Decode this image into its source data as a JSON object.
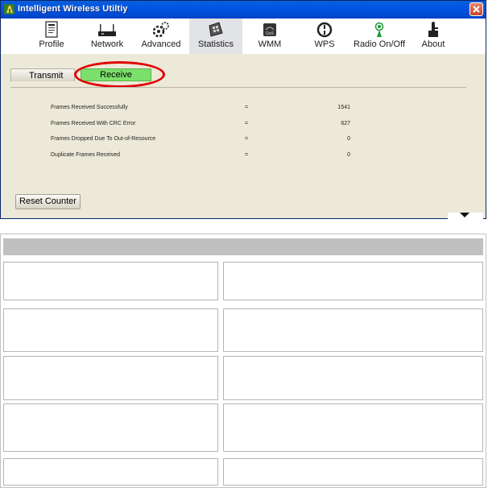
{
  "window": {
    "title": "Intelligent Wireless Utiltiy"
  },
  "toolbar": {
    "items": [
      {
        "label": "Profile",
        "icon": "profile-icon"
      },
      {
        "label": "Network",
        "icon": "network-icon"
      },
      {
        "label": "Advanced",
        "icon": "advanced-icon"
      },
      {
        "label": "Statistics",
        "icon": "statistics-icon",
        "active": true
      },
      {
        "label": "WMM",
        "icon": "wmm-icon"
      },
      {
        "label": "WPS",
        "icon": "wps-icon"
      },
      {
        "label": "Radio On/Off",
        "icon": "radio-icon"
      },
      {
        "label": "About",
        "icon": "about-icon"
      }
    ]
  },
  "tabs": {
    "transmit": "Transmit",
    "receive": "Receive",
    "selected": "Receive"
  },
  "stats": [
    {
      "label": "Frames Received Successfully",
      "sep": "=",
      "value": "1541"
    },
    {
      "label": "Frames Received With CRC Error",
      "sep": "=",
      "value": "627"
    },
    {
      "label": "Frames Dropped Due To Out-of-Resource",
      "sep": "=",
      "value": "0"
    },
    {
      "label": "Duplicate Frames Received",
      "sep": "=",
      "value": "0"
    }
  ],
  "buttons": {
    "reset": "Reset Counter"
  },
  "colors": {
    "titlebar": "#0055e5",
    "selected_tab": "#7be06b",
    "highlight": "#e00000",
    "window_bg": "#ece9d8"
  }
}
